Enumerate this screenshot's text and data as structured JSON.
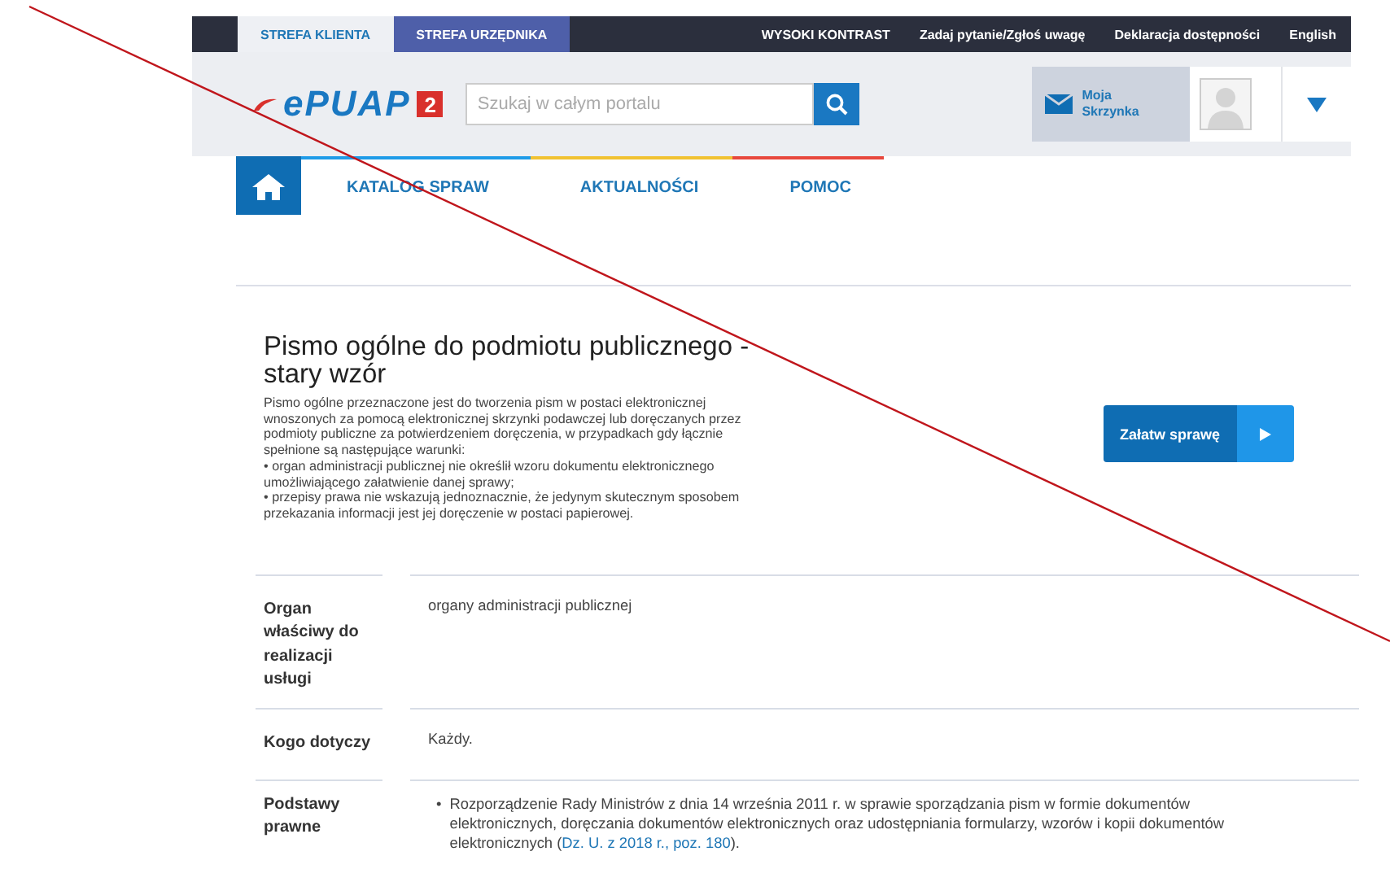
{
  "top_bar": {
    "tabs": [
      {
        "label": "STREFA KLIENTA",
        "selected": true
      },
      {
        "label": "STREFA URZĘDNIKA",
        "selected": false
      }
    ],
    "links": [
      "WYSOKI KONTRAST",
      "Zadaj pytanie/Zgłoś uwagę",
      "Deklaracja dostępności",
      "English"
    ]
  },
  "header": {
    "logo_text": "ePUAP",
    "logo_badge": "2",
    "search": {
      "placeholder": "Szukaj w całym portalu"
    },
    "mailbox": "Moja Skrzynka"
  },
  "nav": {
    "items": [
      "KATALOG SPRAW",
      "AKTUALNOŚCI",
      "POMOC"
    ]
  },
  "service": {
    "title": "Pismo ogólne do podmiotu publicznego - stary wzór",
    "description": [
      "Pismo ogólne przeznaczone jest do tworzenia pism w postaci elektronicznej wnoszonych za pomocą elektronicznej skrzynki podawczej lub doręczanych przez podmioty publiczne za potwierdzeniem doręczenia, w przypadkach gdy łącznie spełnione są następujące warunki:",
      "• organ administracji publicznej nie określił wzoru dokumentu elektronicznego umożliwiającego załatwienie danej sprawy;",
      "• przepisy prawa nie wskazują jednoznacznie, że jedynym skutecznym sposobem przekazania informacji jest jej doręczenie w postaci papierowej."
    ],
    "action": "Załatw sprawę"
  },
  "details": [
    {
      "kind": "text",
      "label": "Organ właściwy do realizacji usługi",
      "value": "organy administracji publicznej"
    },
    {
      "kind": "text",
      "label": "Kogo dotyczy",
      "value": "Każdy."
    },
    {
      "kind": "list",
      "label": "Podstawy prawne",
      "bullet": "•",
      "value": "Rozporządzenie Rady Ministrów z dnia 14 września 2011 r. w sprawie sporządzania pism w formie dokumentów elektronicznych, doręczania dokumentów elektronicznych oraz udostępniania formularzy, wzorów i kopii dokumentów elektronicznych (",
      "link": "Dz. U. z 2018 r., poz. 180",
      "after": ")."
    }
  ]
}
